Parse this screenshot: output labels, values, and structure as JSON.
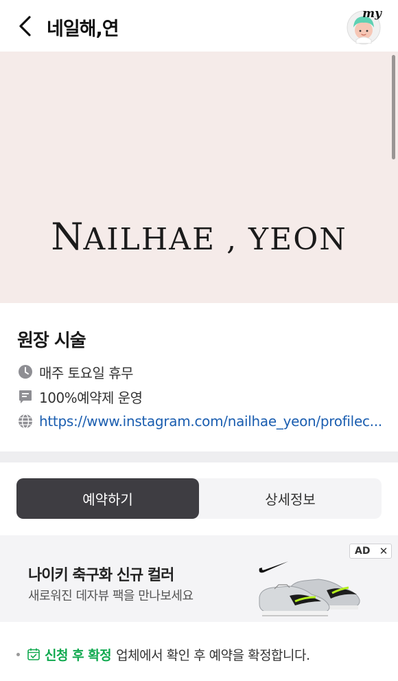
{
  "header": {
    "title": "네일해,연",
    "back_icon": "chevron-left-icon",
    "my_label": "my"
  },
  "banner": {
    "logo_first": "N",
    "logo_rest": "AILHAE , YEON",
    "background": "#f5ebe9"
  },
  "info": {
    "shop_name": "원장 시술",
    "hours": {
      "icon": "clock-icon",
      "text": "매주 토요일 휴무"
    },
    "notice": {
      "icon": "memo-icon",
      "text": "100%예약제 운영"
    },
    "website": {
      "icon": "globe-icon",
      "text": "https://www.instagram.com/nailhae_yeon/profilec..."
    }
  },
  "tabs": [
    {
      "label": "예약하기",
      "active": true
    },
    {
      "label": "상세정보",
      "active": false
    }
  ],
  "ad": {
    "title": "나이키 축구화 신규 컬러",
    "subtitle": "새로워진 데자뷰 팩을 만나보세요",
    "badge": "AD",
    "close": "✕"
  },
  "booking_notice": {
    "icon": "calendar-check-icon",
    "label": "신청 후 확정",
    "text": "업체에서 확인 후 예약을 확정합니다."
  },
  "colors": {
    "accent_green": "#10a94f",
    "link_blue": "#1b5eb0",
    "active_tab": "#3e3d42"
  }
}
